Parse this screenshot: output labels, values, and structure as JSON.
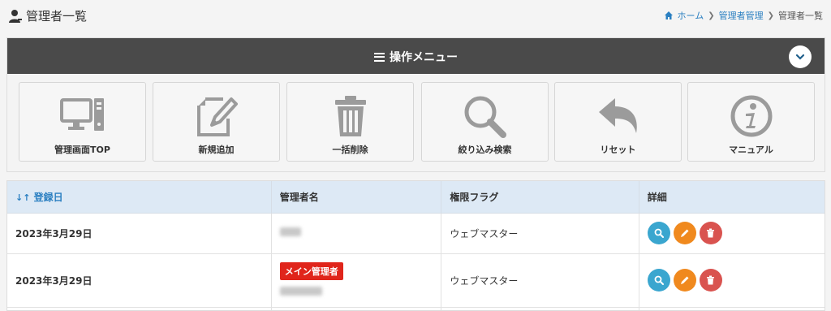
{
  "header": {
    "title": "管理者一覧",
    "breadcrumb": {
      "home": "ホーム",
      "section": "管理者管理",
      "current": "管理者一覧"
    }
  },
  "menu": {
    "title": "操作メニュー",
    "buttons": [
      {
        "label": "管理画面TOP",
        "icon": "monitor-icon"
      },
      {
        "label": "新規追加",
        "icon": "edit-note-icon"
      },
      {
        "label": "一括削除",
        "icon": "trash-icon"
      },
      {
        "label": "絞り込み検索",
        "icon": "search-icon"
      },
      {
        "label": "リセット",
        "icon": "reply-arrow-icon"
      },
      {
        "label": "マニュアル",
        "icon": "info-icon"
      }
    ]
  },
  "table": {
    "headers": {
      "date": "登録日",
      "name": "管理者名",
      "role": "権限フラグ",
      "details": "詳細"
    },
    "rows": [
      {
        "date": "2023年3月29日",
        "badge": "",
        "role": "ウェブマスター"
      },
      {
        "date": "2023年3月29日",
        "badge": "メイン管理者",
        "role": "ウェブマスター"
      }
    ]
  },
  "colors": {
    "menu_bar": "#4a4a4a",
    "table_header": "#dde9f5",
    "link": "#2a7fc1",
    "badge": "#e0251b",
    "view_button": "#3aa6cf",
    "edit_button": "#f0891e",
    "delete_button": "#d9534f"
  }
}
